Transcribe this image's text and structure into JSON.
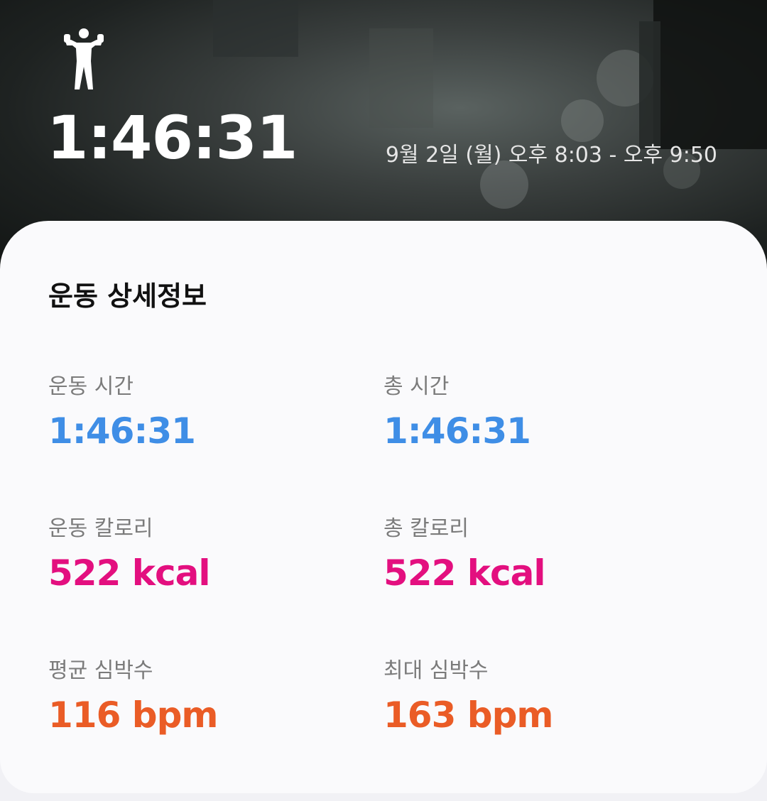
{
  "header": {
    "duration": "1:46:31",
    "time_range": "9월 2일 (월) 오후 8:03 - 오후 9:50",
    "workout_icon": "person-strength-icon"
  },
  "details": {
    "title": "운동 상세정보",
    "stats": [
      {
        "label": "운동 시간",
        "value": "1:46:31",
        "color": "#3f8ee6"
      },
      {
        "label": "총 시간",
        "value": "1:46:31",
        "color": "#3f8ee6"
      },
      {
        "label": "운동 칼로리",
        "value": "522 kcal",
        "color": "#e30f7f"
      },
      {
        "label": "총 칼로리",
        "value": "522 kcal",
        "color": "#e30f7f"
      },
      {
        "label": "평균 심박수",
        "value": "116 bpm",
        "color": "#ea5c26"
      },
      {
        "label": "최대 심박수",
        "value": "163 bpm",
        "color": "#ea5c26"
      }
    ]
  }
}
